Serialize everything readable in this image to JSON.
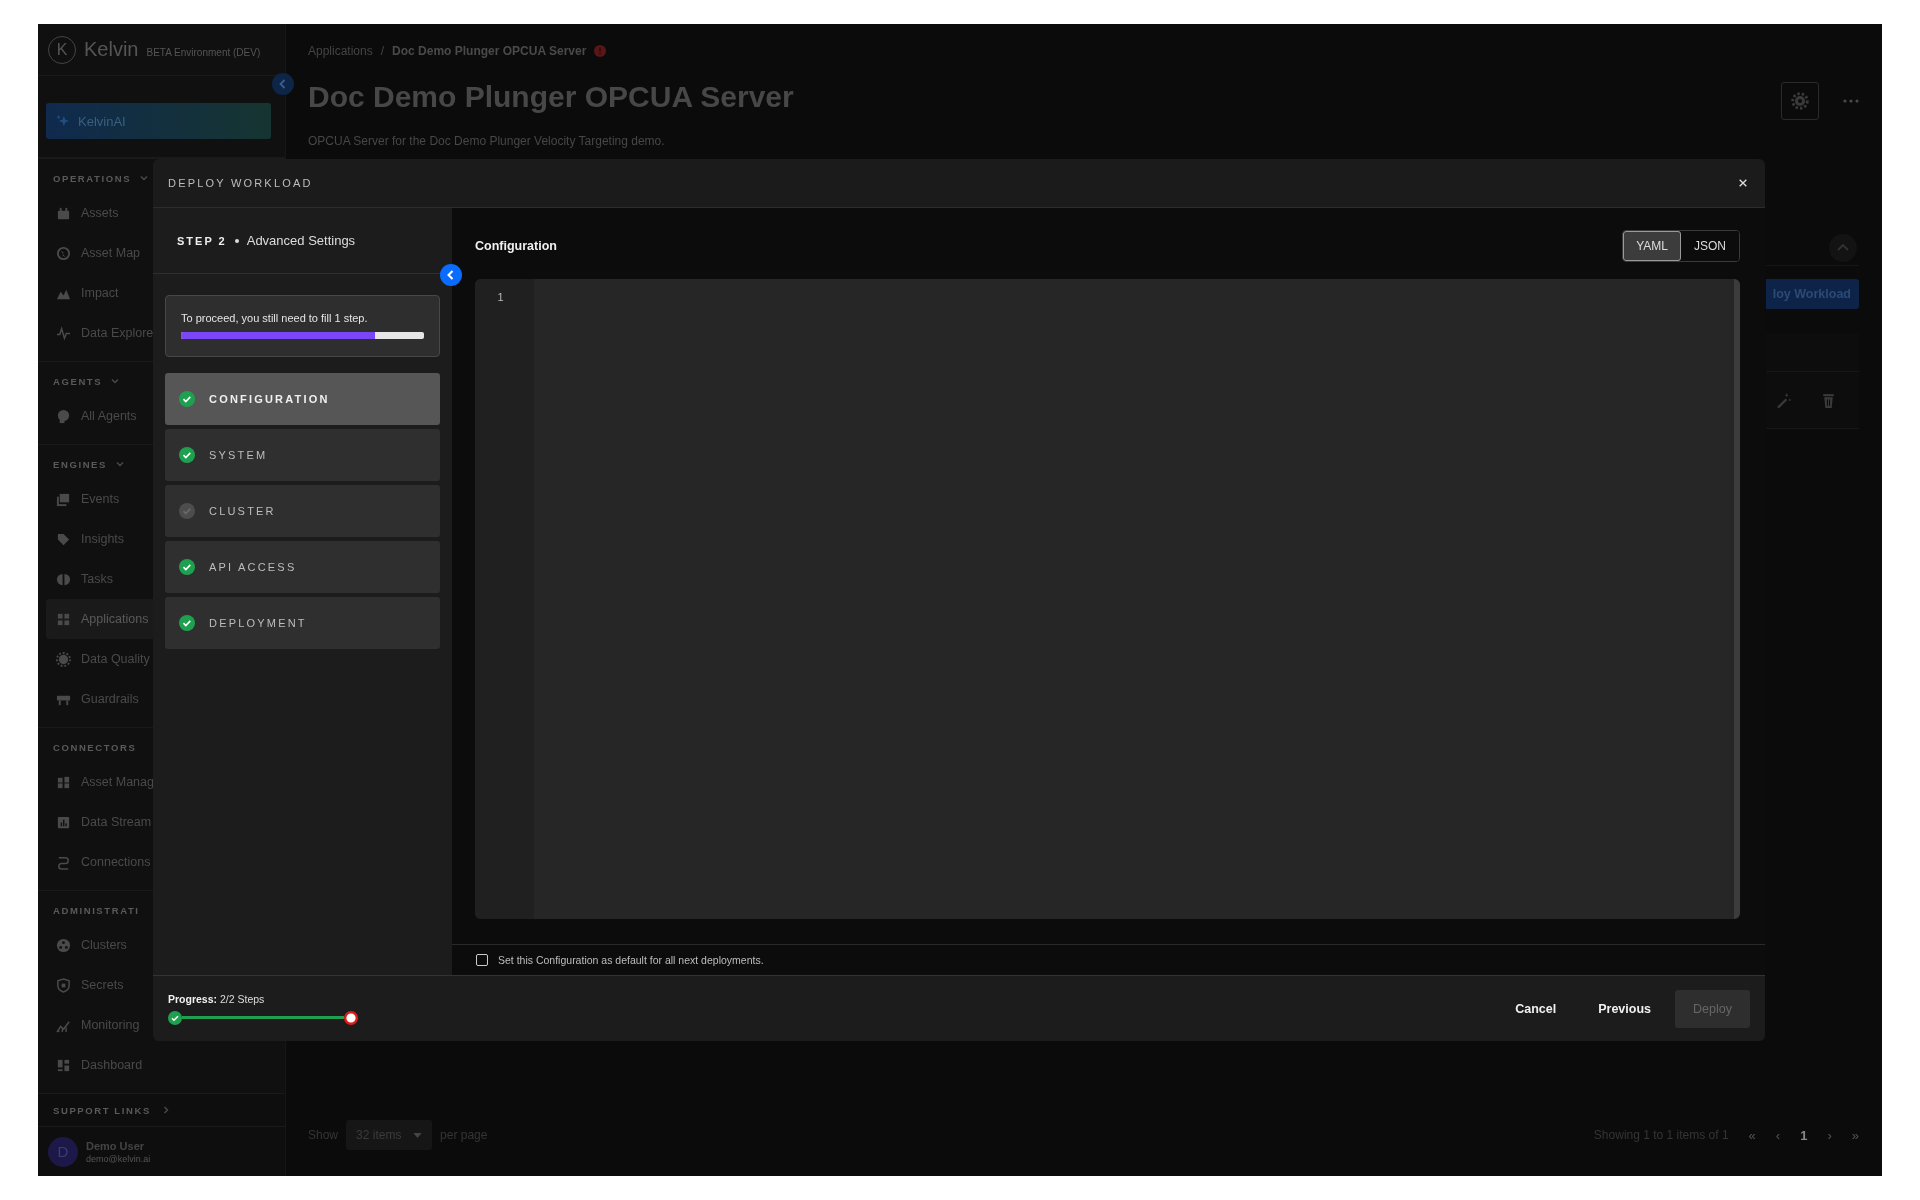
{
  "app": {
    "logo_mark": "K",
    "logo": "Kelvin",
    "environment": "BETA Environment (DEV)",
    "ai_button": "KelvinAI"
  },
  "sidebar": {
    "sections": [
      {
        "title": "OPERATIONS",
        "expanded": true,
        "items": [
          {
            "label": "Assets",
            "selected": false
          },
          {
            "label": "Asset Map",
            "selected": false
          },
          {
            "label": "Impact",
            "selected": false
          },
          {
            "label": "Data Explore",
            "selected": false
          }
        ]
      },
      {
        "title": "AGENTS",
        "expanded": true,
        "items": [
          {
            "label": "All Agents",
            "selected": false
          }
        ]
      },
      {
        "title": "ENGINES",
        "expanded": true,
        "items": [
          {
            "label": "Events",
            "selected": false
          },
          {
            "label": "Insights",
            "selected": false
          },
          {
            "label": "Tasks",
            "selected": false
          },
          {
            "label": "Applications",
            "selected": true
          },
          {
            "label": "Data Quality",
            "selected": false
          },
          {
            "label": "Guardrails",
            "selected": false
          }
        ]
      },
      {
        "title": "CONNECTORS",
        "items": [
          {
            "label": "Asset Manag",
            "selected": false
          },
          {
            "label": "Data Stream",
            "selected": false
          },
          {
            "label": "Connections",
            "selected": false
          }
        ]
      },
      {
        "title": "ADMINISTRATI",
        "items": [
          {
            "label": "Clusters",
            "selected": false
          },
          {
            "label": "Secrets",
            "selected": false
          },
          {
            "label": "Monitoring",
            "selected": false
          },
          {
            "label": "Dashboard",
            "selected": false
          }
        ]
      }
    ],
    "support_links": {
      "title": "SUPPORT LINKS",
      "expanded": false
    },
    "user": {
      "initial": "D",
      "name": "Demo User",
      "email": "demo@kelvin.ai"
    }
  },
  "page": {
    "breadcrumb": [
      "Applications",
      "Doc Demo Plunger OPCUA Server"
    ],
    "breadcrumb_separator": "/",
    "title": "Doc Demo Plunger OPCUA Server",
    "subtitle": "OPCUA Server for the Doc Demo Plunger Velocity Targeting demo.",
    "deploy_button": "loy Workload",
    "pagination": {
      "show": "Show",
      "page_size": "32 items",
      "per_page": "per page",
      "summary": "Showing 1 to 1 items of 1",
      "pages": [
        {
          "label": "«",
          "selected": false
        },
        {
          "label": "‹",
          "selected": false
        },
        {
          "label": "1",
          "selected": true
        },
        {
          "label": "›",
          "selected": false
        },
        {
          "label": "»",
          "selected": false
        }
      ]
    }
  },
  "modal": {
    "title": "DEPLOY WORKLOAD",
    "step_label": "STEP 2",
    "step_name": "Advanced Settings",
    "notice": {
      "text": "To proceed, you still need to fill 1 step.",
      "level": 0.8
    },
    "steps": [
      {
        "label": "CONFIGURATION",
        "done": true,
        "selected": true
      },
      {
        "label": "SYSTEM",
        "done": true,
        "selected": false
      },
      {
        "label": "CLUSTER",
        "done": false,
        "selected": false
      },
      {
        "label": "API ACCESS",
        "done": true,
        "selected": false
      },
      {
        "label": "DEPLOYMENT",
        "done": true,
        "selected": false
      }
    ],
    "editor": {
      "title": "Configuration",
      "formats": [
        {
          "label": "YAML",
          "selected": true
        },
        {
          "label": "JSON",
          "selected": false
        }
      ],
      "line_numbers": [
        "1"
      ]
    },
    "default_option": {
      "label": "Set this Configuration as default for all next deployments.",
      "checked": false
    },
    "progress": {
      "label": "Progress:",
      "value": "2/2 Steps",
      "level": 1
    },
    "buttons": [
      {
        "label": "Cancel",
        "kind": "text",
        "disabled": false
      },
      {
        "label": "Previous",
        "kind": "text",
        "disabled": false
      },
      {
        "label": "Deploy",
        "kind": "primary",
        "disabled": true
      }
    ]
  }
}
